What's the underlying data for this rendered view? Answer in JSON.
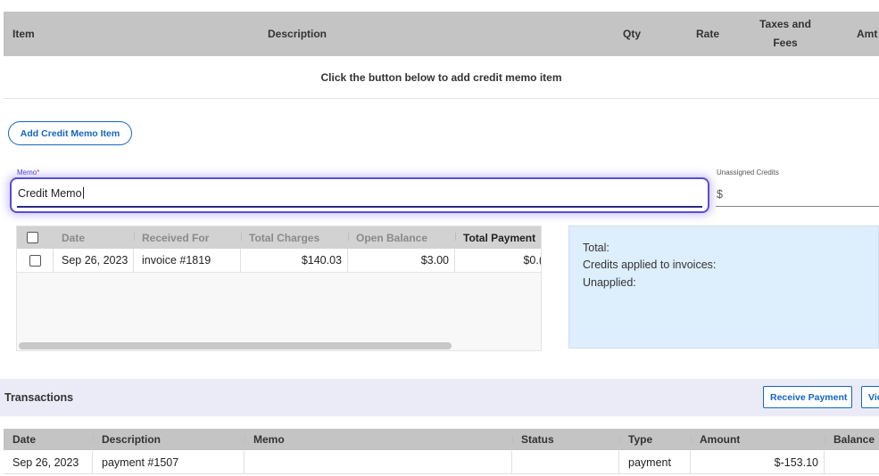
{
  "items_table": {
    "columns": [
      "Item",
      "Description",
      "Qty",
      "Rate",
      "Taxes and",
      "Fees",
      "Amt"
    ],
    "empty_message": "Click the button below to add credit memo item"
  },
  "add_item_button": "Add Credit Memo Item",
  "memo": {
    "label": "Memo",
    "required_mark": "*",
    "value": "Credit Memo"
  },
  "unassigned_credits": {
    "label": "Unassigned Credits",
    "currency": "$"
  },
  "invoice_grid": {
    "columns": [
      "Date",
      "Received For",
      "Total Charges",
      "Open Balance",
      "Total Payment"
    ],
    "rows": [
      {
        "checked": false,
        "date": "Sep 26, 2023",
        "received_for": "invoice #1819",
        "total_charges": "$140.03",
        "open_balance": "$3.00",
        "total_payment": "$0.("
      }
    ]
  },
  "totals_panel": {
    "total_label": "Total:",
    "credits_label": "Credits applied to invoices:",
    "unapplied_label": "Unapplied:"
  },
  "transactions": {
    "title": "Transactions",
    "receive_payment_button": "Receive Payment",
    "view_button": "Vie",
    "columns": [
      "Date",
      "Description",
      "Memo",
      "Status",
      "Type",
      "Amount",
      "Balance"
    ],
    "rows": [
      {
        "date": "Sep 26, 2023",
        "description": "payment #1507",
        "memo": "",
        "status": "",
        "type": "payment",
        "amount": "$-153.10",
        "balance": ""
      }
    ]
  },
  "colors": {
    "accent_blue": "#1565c0",
    "focus_purple": "#5b4bd6",
    "header_gray": "#c4c4c4",
    "totals_bg": "#ddeefc",
    "transactions_bar": "#ebebf8"
  }
}
